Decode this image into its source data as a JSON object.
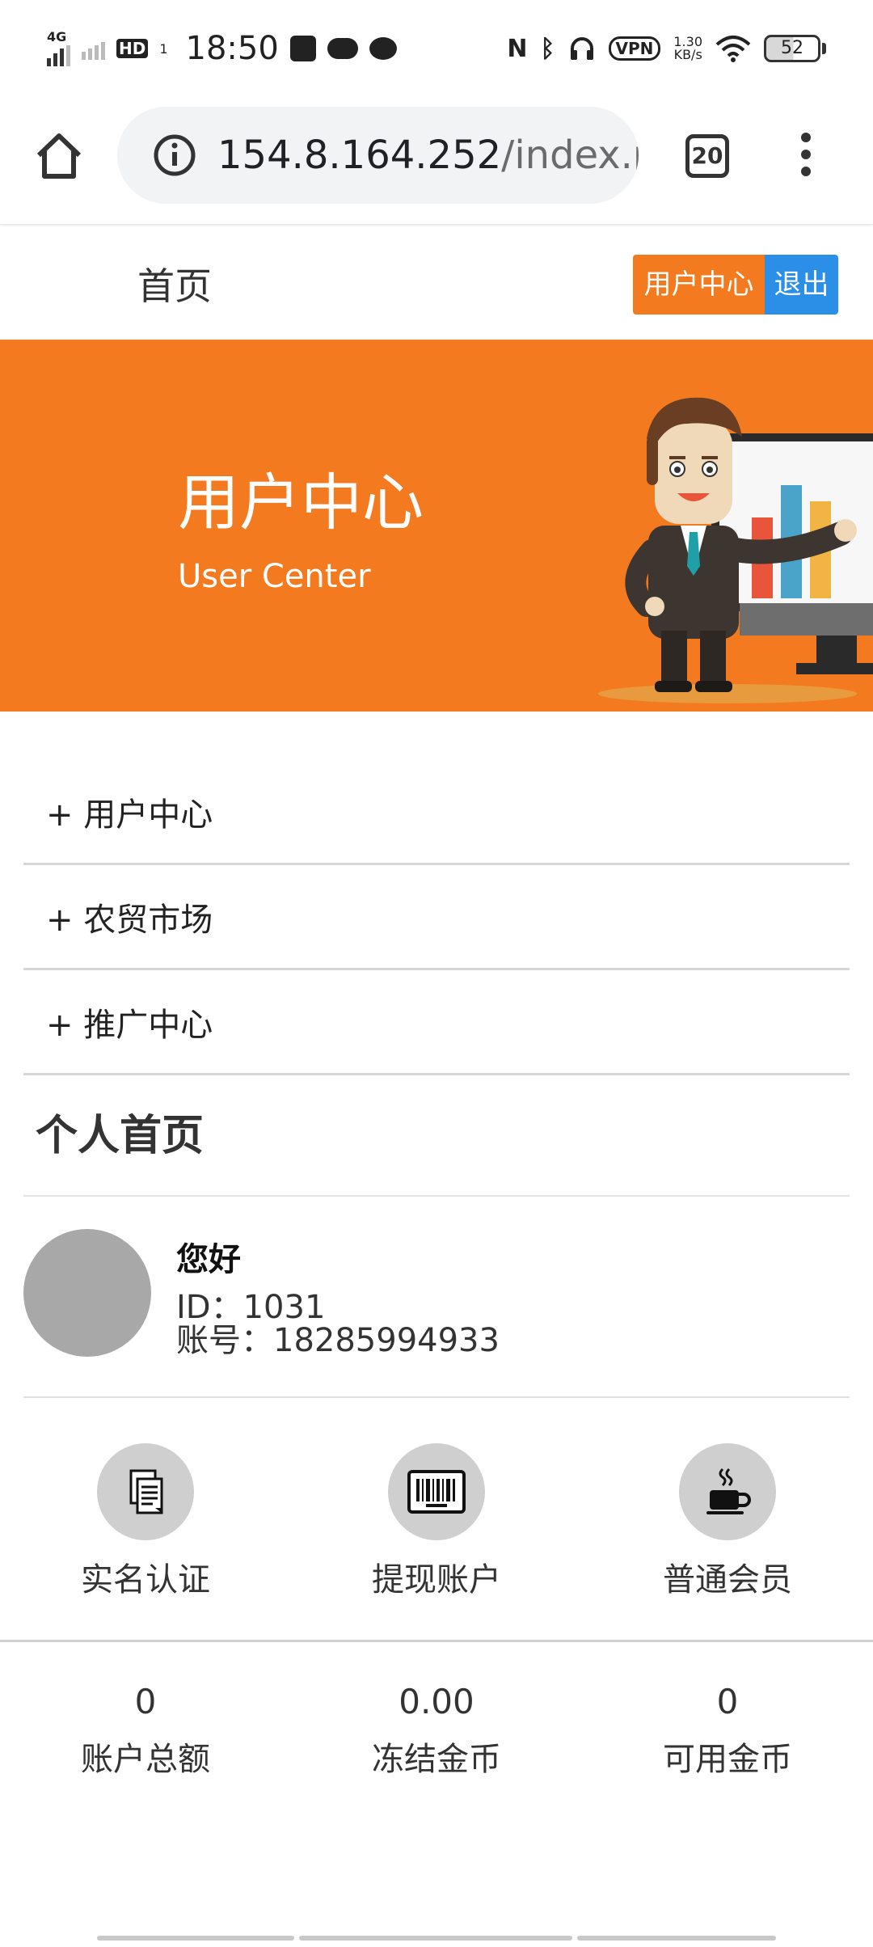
{
  "status_bar": {
    "network": "4G",
    "hd": "HD",
    "hd_sub": "1",
    "time": "18:50",
    "vpn": "VPN",
    "speed_value": "1.30",
    "speed_unit": "KB/s",
    "battery": "52"
  },
  "browser": {
    "url_host": "154.8.164.252",
    "url_path": "/index.p",
    "tab_count": "20"
  },
  "header": {
    "home_link": "首页",
    "user_center_button": "用户中心",
    "logout_button": "退出",
    "accent_color": "#f47a1f",
    "logout_color": "#2b8fe8"
  },
  "banner": {
    "title": "用户中心",
    "subtitle": "User Center"
  },
  "menu": {
    "items": [
      {
        "label": "+ 用户中心"
      },
      {
        "label": "+ 农贸市场"
      },
      {
        "label": "+ 推广中心"
      }
    ]
  },
  "profile": {
    "section_title": "个人首页",
    "greeting": "您好",
    "id_line": "ID：1031",
    "account_line": "账号：18285994933"
  },
  "actions": [
    {
      "label": "实名认证",
      "icon": "document-icon"
    },
    {
      "label": "提现账户",
      "icon": "barcode-icon"
    },
    {
      "label": "普通会员",
      "icon": "coffee-cup-icon"
    }
  ],
  "stats": [
    {
      "value": "0",
      "label": "账户总额"
    },
    {
      "value": "0.00",
      "label": "冻结金币"
    },
    {
      "value": "0",
      "label": "可用金币"
    }
  ]
}
